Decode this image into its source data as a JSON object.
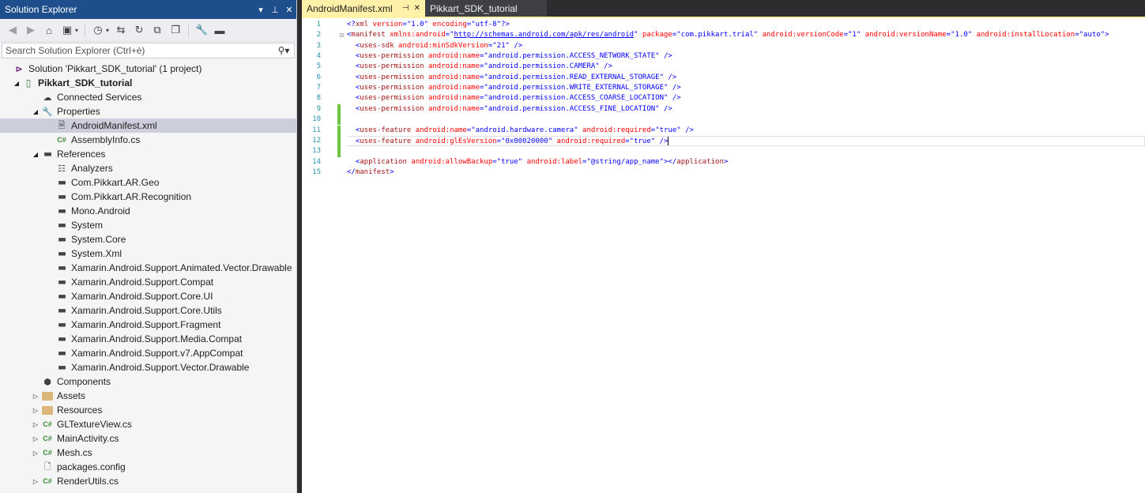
{
  "solution_explorer": {
    "title": "Solution Explorer",
    "search_placeholder": "Search Solution Explorer (Ctrl+è)",
    "items": [
      {
        "label": "Solution 'Pikkart_SDK_tutorial' (1 project)",
        "level": 0,
        "icon": "solution-icon",
        "expander": ""
      },
      {
        "label": "Pikkart_SDK_tutorial",
        "level": 0,
        "icon": "project-icon",
        "expander": "expanded",
        "bold": true
      },
      {
        "label": "Connected Services",
        "level": 1,
        "icon": "cloud-icon",
        "expander": ""
      },
      {
        "label": "Properties",
        "level": 1,
        "icon": "wrench-icon",
        "expander": "expanded"
      },
      {
        "label": "AndroidManifest.xml",
        "level": 2,
        "icon": "xml-file-icon",
        "expander": "",
        "selected": true
      },
      {
        "label": "AssemblyInfo.cs",
        "level": 2,
        "icon": "csharp-icon",
        "expander": ""
      },
      {
        "label": "References",
        "level": 1,
        "icon": "reference-icon",
        "expander": "expanded"
      },
      {
        "label": "Analyzers",
        "level": 2,
        "icon": "analyzer-icon",
        "expander": ""
      },
      {
        "label": "Com.Pikkart.AR.Geo",
        "level": 2,
        "icon": "reference-icon",
        "expander": ""
      },
      {
        "label": "Com.Pikkart.AR.Recognition",
        "level": 2,
        "icon": "reference-icon",
        "expander": ""
      },
      {
        "label": "Mono.Android",
        "level": 2,
        "icon": "reference-icon",
        "expander": ""
      },
      {
        "label": "System",
        "level": 2,
        "icon": "reference-icon",
        "expander": ""
      },
      {
        "label": "System.Core",
        "level": 2,
        "icon": "reference-icon",
        "expander": ""
      },
      {
        "label": "System.Xml",
        "level": 2,
        "icon": "reference-icon",
        "expander": ""
      },
      {
        "label": "Xamarin.Android.Support.Animated.Vector.Drawable",
        "level": 2,
        "icon": "reference-icon",
        "expander": ""
      },
      {
        "label": "Xamarin.Android.Support.Compat",
        "level": 2,
        "icon": "reference-icon",
        "expander": ""
      },
      {
        "label": "Xamarin.Android.Support.Core.UI",
        "level": 2,
        "icon": "reference-icon",
        "expander": ""
      },
      {
        "label": "Xamarin.Android.Support.Core.Utils",
        "level": 2,
        "icon": "reference-icon",
        "expander": ""
      },
      {
        "label": "Xamarin.Android.Support.Fragment",
        "level": 2,
        "icon": "reference-icon",
        "expander": ""
      },
      {
        "label": "Xamarin.Android.Support.Media.Compat",
        "level": 2,
        "icon": "reference-icon",
        "expander": ""
      },
      {
        "label": "Xamarin.Android.Support.v7.AppCompat",
        "level": 2,
        "icon": "reference-icon",
        "expander": ""
      },
      {
        "label": "Xamarin.Android.Support.Vector.Drawable",
        "level": 2,
        "icon": "reference-icon",
        "expander": ""
      },
      {
        "label": "Components",
        "level": 1,
        "icon": "component-icon",
        "expander": ""
      },
      {
        "label": "Assets",
        "level": 1,
        "icon": "folder-icon",
        "expander": "collapsed"
      },
      {
        "label": "Resources",
        "level": 1,
        "icon": "folder-icon",
        "expander": "collapsed"
      },
      {
        "label": "GLTextureView.cs",
        "level": 1,
        "icon": "csharp-icon",
        "expander": "collapsed"
      },
      {
        "label": "MainActivity.cs",
        "level": 1,
        "icon": "csharp-icon",
        "expander": "collapsed"
      },
      {
        "label": "Mesh.cs",
        "level": 1,
        "icon": "csharp-icon",
        "expander": "collapsed"
      },
      {
        "label": "packages.config",
        "level": 1,
        "icon": "config-file-icon",
        "expander": ""
      },
      {
        "label": "RenderUtils.cs",
        "level": 1,
        "icon": "csharp-icon",
        "expander": "collapsed"
      }
    ]
  },
  "tabs": [
    {
      "label": "AndroidManifest.xml",
      "active": true
    },
    {
      "label": "Pikkart_SDK_tutorial",
      "active": false
    }
  ],
  "editor": {
    "lines": [
      {
        "n": "1",
        "changed": false,
        "tokens": [
          [
            "b",
            "<?"
          ],
          [
            "m",
            "xml"
          ],
          [
            "a",
            " version"
          ],
          [
            "b",
            "="
          ],
          [
            "v",
            "\"1.0\""
          ],
          [
            "a",
            " encoding"
          ],
          [
            "b",
            "="
          ],
          [
            "v",
            "\"utf-8\""
          ],
          [
            "b",
            "?>"
          ]
        ]
      },
      {
        "n": "2",
        "changed": false,
        "fold": true,
        "tokens": [
          [
            "b",
            "<"
          ],
          [
            "m",
            "manifest"
          ],
          [
            "a",
            " xmlns:android"
          ],
          [
            "b",
            "="
          ],
          [
            "v",
            "\""
          ],
          [
            "l",
            "http://schemas.android.com/apk/res/android"
          ],
          [
            "v",
            "\""
          ],
          [
            "a",
            " package"
          ],
          [
            "b",
            "="
          ],
          [
            "v",
            "\"com.pikkart.trial\""
          ],
          [
            "a",
            " android:versionCode"
          ],
          [
            "b",
            "="
          ],
          [
            "v",
            "\"1\""
          ],
          [
            "a",
            " android:versionName"
          ],
          [
            "b",
            "="
          ],
          [
            "v",
            "\"1.0\""
          ],
          [
            "a",
            " android:installLocation"
          ],
          [
            "b",
            "="
          ],
          [
            "v",
            "\"auto\""
          ],
          [
            "b",
            ">"
          ]
        ]
      },
      {
        "n": "3",
        "changed": false,
        "tokens": [
          [
            "b",
            "  <"
          ],
          [
            "m",
            "uses-sdk"
          ],
          [
            "a",
            " android:minSdkVersion"
          ],
          [
            "b",
            "="
          ],
          [
            "v",
            "\"21\""
          ],
          [
            "b",
            " />"
          ]
        ]
      },
      {
        "n": "4",
        "changed": false,
        "tokens": [
          [
            "b",
            "  <"
          ],
          [
            "m",
            "uses-permission"
          ],
          [
            "a",
            " android:name"
          ],
          [
            "b",
            "="
          ],
          [
            "v",
            "\"android.permission.ACCESS_NETWORK_STATE\""
          ],
          [
            "b",
            " />"
          ]
        ]
      },
      {
        "n": "5",
        "changed": false,
        "tokens": [
          [
            "b",
            "  <"
          ],
          [
            "m",
            "uses-permission"
          ],
          [
            "a",
            " android:name"
          ],
          [
            "b",
            "="
          ],
          [
            "v",
            "\"android.permission.CAMERA\""
          ],
          [
            "b",
            " />"
          ]
        ]
      },
      {
        "n": "6",
        "changed": false,
        "tokens": [
          [
            "b",
            "  <"
          ],
          [
            "m",
            "uses-permission"
          ],
          [
            "a",
            " android:name"
          ],
          [
            "b",
            "="
          ],
          [
            "v",
            "\"android.permission.READ_EXTERNAL_STORAGE\""
          ],
          [
            "b",
            " />"
          ]
        ]
      },
      {
        "n": "7",
        "changed": false,
        "tokens": [
          [
            "b",
            "  <"
          ],
          [
            "m",
            "uses-permission"
          ],
          [
            "a",
            " android:name"
          ],
          [
            "b",
            "="
          ],
          [
            "v",
            "\"android.permission.WRITE_EXTERNAL_STORAGE\""
          ],
          [
            "b",
            " />"
          ]
        ]
      },
      {
        "n": "8",
        "changed": false,
        "tokens": [
          [
            "b",
            "  <"
          ],
          [
            "m",
            "uses-permission"
          ],
          [
            "a",
            " android:name"
          ],
          [
            "b",
            "="
          ],
          [
            "v",
            "\"android.permission.ACCESS_COARSE_LOCATION\""
          ],
          [
            "b",
            " />"
          ]
        ]
      },
      {
        "n": "9",
        "changed": true,
        "tokens": [
          [
            "b",
            "  <"
          ],
          [
            "m",
            "uses-permission"
          ],
          [
            "a",
            " android:name"
          ],
          [
            "b",
            "="
          ],
          [
            "v",
            "\"android.permission.ACCESS_FINE_LOCATION\""
          ],
          [
            "b",
            " />"
          ]
        ]
      },
      {
        "n": "10",
        "changed": true,
        "tokens": []
      },
      {
        "n": "11",
        "changed": true,
        "tokens": [
          [
            "b",
            "  <"
          ],
          [
            "m",
            "uses-feature"
          ],
          [
            "a",
            " android:name"
          ],
          [
            "b",
            "="
          ],
          [
            "v",
            "\"android.hardware.camera\""
          ],
          [
            "a",
            " android:required"
          ],
          [
            "b",
            "="
          ],
          [
            "v",
            "\"true\""
          ],
          [
            "b",
            " />"
          ]
        ]
      },
      {
        "n": "12",
        "changed": true,
        "current": true,
        "tokens": [
          [
            "b",
            "  <"
          ],
          [
            "m",
            "uses-feature"
          ],
          [
            "a",
            " android:glEsVersion"
          ],
          [
            "b",
            "="
          ],
          [
            "v",
            "\"0x00020000\""
          ],
          [
            "a",
            " android:required"
          ],
          [
            "b",
            "="
          ],
          [
            "v",
            "\"true\""
          ],
          [
            "b",
            " />"
          ]
        ]
      },
      {
        "n": "13",
        "changed": true,
        "tokens": []
      },
      {
        "n": "14",
        "changed": false,
        "tokens": [
          [
            "b",
            "  <"
          ],
          [
            "m",
            "application"
          ],
          [
            "a",
            " android:allowBackup"
          ],
          [
            "b",
            "="
          ],
          [
            "v",
            "\"true\""
          ],
          [
            "a",
            " android:label"
          ],
          [
            "b",
            "="
          ],
          [
            "v",
            "\"@string/app_name\""
          ],
          [
            "b",
            "></"
          ],
          [
            "m",
            "application"
          ],
          [
            "b",
            ">"
          ]
        ]
      },
      {
        "n": "15",
        "changed": false,
        "tokens": [
          [
            "b",
            "</"
          ],
          [
            "m",
            "manifest"
          ],
          [
            "b",
            ">"
          ]
        ]
      }
    ]
  }
}
